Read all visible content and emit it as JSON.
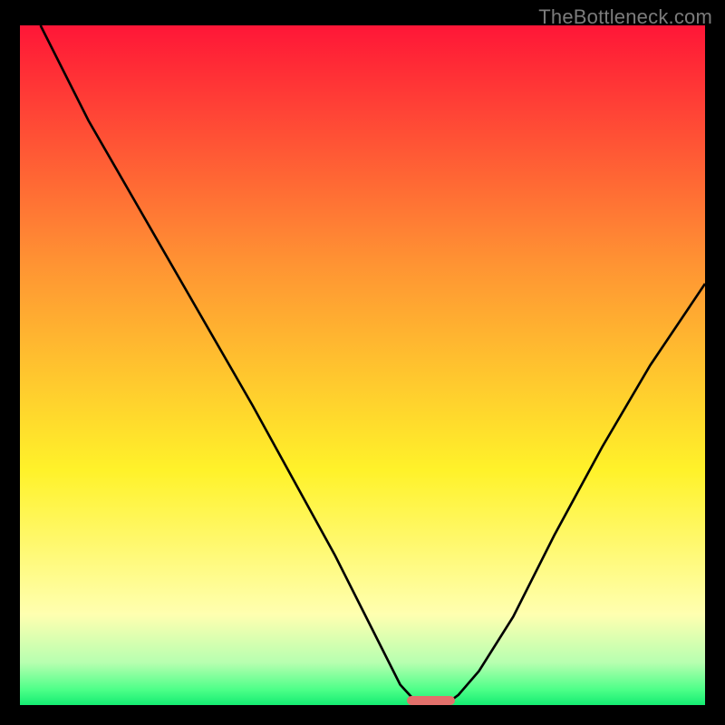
{
  "watermark": "TheBottleneck.com",
  "colors": {
    "black": "#000000",
    "red": "#ff1637",
    "orange": "#ff9433",
    "yellow": "#fff22a",
    "paleYellow": "#ffffb0",
    "lightGreen": "#8aff8a",
    "green": "#00e56a",
    "marker": "#e2706b",
    "curve": "#000000"
  },
  "chart_data": {
    "type": "line",
    "title": "",
    "xlabel": "",
    "ylabel": "",
    "xlim": [
      0,
      100
    ],
    "ylim": [
      0,
      100
    ],
    "series": [
      {
        "name": "left-branch",
        "x": [
          3,
          10,
          18,
          26,
          34,
          40,
          46,
          50,
          53,
          55.5,
          57.5,
          57.8
        ],
        "values": [
          100,
          86,
          72,
          58,
          44,
          33,
          22,
          14,
          8,
          3,
          0.8,
          0
        ]
      },
      {
        "name": "right-branch",
        "x": [
          62,
          64,
          67,
          72,
          78,
          85,
          92,
          100
        ],
        "values": [
          0,
          1.5,
          5,
          13,
          25,
          38,
          50,
          62
        ]
      }
    ],
    "annotations": [
      {
        "name": "min-marker",
        "x": 60,
        "y": 0,
        "width_pct": 7,
        "height_pct": 1.4
      }
    ],
    "gradient_stops": [
      {
        "pct": 0,
        "color": "#ff1637"
      },
      {
        "pct": 35,
        "color": "#ff9433"
      },
      {
        "pct": 65,
        "color": "#fff22a"
      },
      {
        "pct": 86,
        "color": "#ffffb0"
      },
      {
        "pct": 93,
        "color": "#b7ffb0"
      },
      {
        "pct": 97,
        "color": "#4cff88"
      },
      {
        "pct": 100,
        "color": "#00e56a"
      }
    ]
  }
}
